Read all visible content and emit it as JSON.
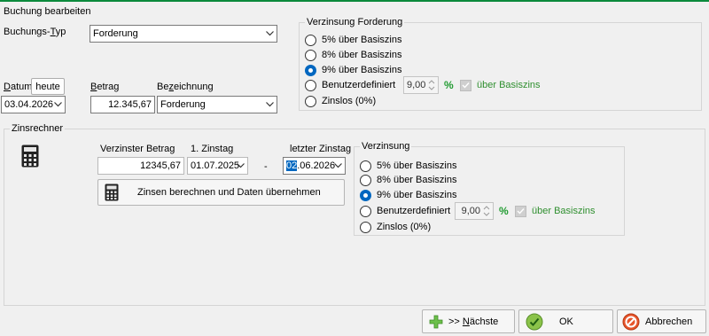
{
  "header": {
    "title": "Buchung bearbeiten"
  },
  "booking": {
    "type_label_pre": "Buchungs-",
    "type_label_ul": "T",
    "type_label_post": "yp",
    "type_value": "Forderung",
    "date_label_pre": "",
    "date_label_ul": "D",
    "date_label_post": "atum",
    "today_button": "heute",
    "date_value": "03.04.2026",
    "amount_label_ul": "B",
    "amount_label_post": "etrag",
    "amount_value": "12.345,67",
    "desc_label_pre": "Be",
    "desc_label_ul": "z",
    "desc_label_post": "eichnung",
    "desc_value": "Forderung"
  },
  "interest_claim": {
    "title": "Verzinsung Forderung",
    "options": [
      "5% über Basiszins",
      "8% über Basiszins",
      "9% über Basiszins",
      "Benutzerdefiniert",
      "Zinslos (0%)"
    ],
    "selected_index": 2,
    "custom_value": "9,00",
    "percent_sign": "%",
    "over_base_label": "über Basiszins"
  },
  "calculator": {
    "title": "Zinsrechner",
    "interest_amount_label": "Verzinster Betrag",
    "interest_amount_value": "12345,67",
    "first_day_label": "1. Zinstag",
    "first_day_value": "01.07.2025",
    "dash": "-",
    "last_day_label": "letzter Zinstag",
    "last_day_selected": "02",
    "last_day_rest": ".06.2026",
    "calc_button": "Zinsen berechnen und Daten übernehmen",
    "interest": {
      "title": "Verzinsung",
      "options": [
        "5% über Basiszins",
        "8% über Basiszins",
        "9% über Basiszins",
        "Benutzerdefiniert",
        "Zinslos (0%)"
      ],
      "selected_index": 2,
      "custom_value": "9,00",
      "percent_sign": "%",
      "over_base_label": "über Basiszins"
    }
  },
  "footer": {
    "next_pre": ">> ",
    "next_ul": "N",
    "next_post": "ächste",
    "ok_label": "OK",
    "cancel_label": "Abbrechen"
  },
  "colors": {
    "accent": "#0b8a3c",
    "radio_selected": "#0067c0",
    "percent_green": "#1f9a2f"
  }
}
